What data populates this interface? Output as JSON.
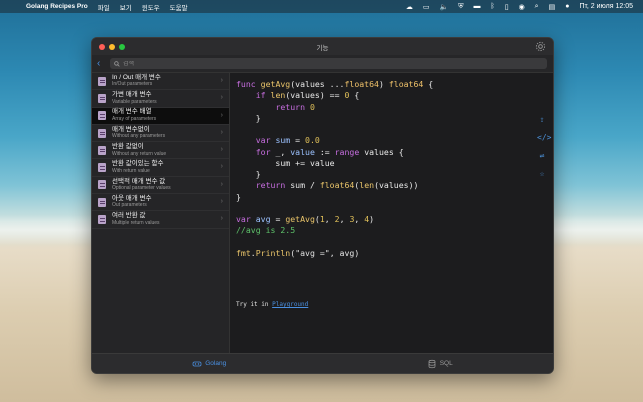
{
  "menubar": {
    "app_name": "Golang Recipes Pro",
    "menus": [
      "파일",
      "보기",
      "윈도우",
      "도움말"
    ],
    "datetime": "Пт, 2 июля 12:05"
  },
  "window": {
    "title": "기능",
    "search": {
      "placeholder": "검색",
      "value": ""
    }
  },
  "sidebar": {
    "items": [
      {
        "title": "In / Out 매개 변수",
        "subtitle": "In/Out parameters"
      },
      {
        "title": "가변 매개 변수",
        "subtitle": "Variable parameters"
      },
      {
        "title": "매개 변수 배열",
        "subtitle": "Array of parameters",
        "selected": true
      },
      {
        "title": "매개 변수없이",
        "subtitle": "Without any parameters"
      },
      {
        "title": "반환 값없이",
        "subtitle": "Without any return value"
      },
      {
        "title": "반환 값이있는 함수",
        "subtitle": "With return value"
      },
      {
        "title": "선택적 매개 변수 값",
        "subtitle": "Optional parameter values"
      },
      {
        "title": "아웃 매개 변수",
        "subtitle": "Out parameters"
      },
      {
        "title": "여러 반환 값",
        "subtitle": "Multiple return values"
      }
    ]
  },
  "code": {
    "try_prefix": "Try it in",
    "playground_link": "Playground"
  },
  "bottombar": {
    "tabs": [
      {
        "label": "Golang",
        "active": true
      },
      {
        "label": "SQL",
        "active": false
      }
    ]
  },
  "colors": {
    "accent": "#4a90e2",
    "keyword": "#c76ee0",
    "comment": "#5ec26a"
  }
}
